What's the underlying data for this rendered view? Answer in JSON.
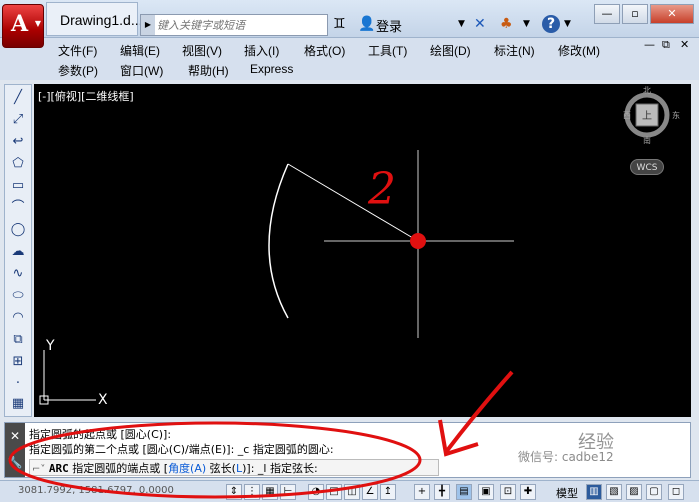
{
  "titlebar": {
    "app_icon": "autocad-logo",
    "doc_title": "Drawing1.d...",
    "search_placeholder": "键入关键字或短语",
    "login": "登录",
    "help": "?"
  },
  "menu_row1": [
    "文件(F)",
    "编辑(E)",
    "视图(V)",
    "插入(I)",
    "格式(O)",
    "工具(T)",
    "绘图(D)",
    "标注(N)",
    "修改(M)"
  ],
  "menu_row2": [
    "参数(P)",
    "窗口(W)",
    "帮助(H)",
    "Express"
  ],
  "canvas": {
    "view_label": "[-][俯视][二维线框]",
    "compass": {
      "north": "北",
      "south": "南",
      "east": "东",
      "west": "西",
      "center": "上"
    },
    "wcs": "WCS",
    "ucs_x": "X",
    "ucs_y": "Y",
    "annotation_number": "2"
  },
  "command": {
    "line1": "指定圆弧的起点或 [圆心(C)]:",
    "line2": "指定圆弧的第二个点或 [圆心(C)/端点(E)]: _c 指定圆弧的圆心:",
    "prompt_cmd": "ARC",
    "prompt_text": " 指定圆弧的端点或 [",
    "opt_angle": "角度(A)",
    "sep": " 弦长(",
    "opt_chord_key": "L",
    "prompt_tail": ")]: _l 指定弦长:"
  },
  "status": {
    "coords": "3081.7992, 1581.6797, 0.0000",
    "model": "模型"
  },
  "watermark": {
    "jingyan": "经验",
    "wechat": "微信号: cadbe12"
  }
}
